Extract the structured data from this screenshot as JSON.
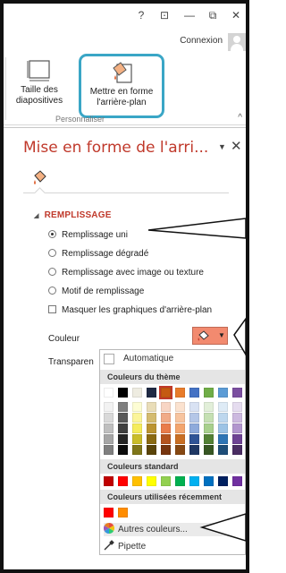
{
  "titlebar": {
    "help": "?",
    "restore_ribbon": "⊡",
    "minimize": "—",
    "maximize": "⧉",
    "close": "✕"
  },
  "account": {
    "signin_label": "Connexion"
  },
  "ribbon": {
    "slide_size_label": "Taille des diapositives",
    "format_background_label": "Mettre en forme l'arrière-plan",
    "group_label": "Personnaliser",
    "collapse": "^"
  },
  "pane": {
    "title": "Mise en forme de l'arri...",
    "dropdown": "▼",
    "close": "✕",
    "section_title": "REMPLISSAGE",
    "fill_options": [
      {
        "label": "Remplissage uni",
        "selected": true
      },
      {
        "label": "Remplissage dégradé",
        "selected": false
      },
      {
        "label": "Remplissage avec image ou texture",
        "selected": false
      },
      {
        "label": "Motif de remplissage",
        "selected": false
      }
    ],
    "hide_graphics_label": "Masquer les graphiques d'arrière-plan",
    "color_label": "Couleur",
    "transparency_label": "Transparen",
    "color_button_color": "#f28a6f"
  },
  "color_menu": {
    "automatic_label": "Automatique",
    "theme_colors_header": "Couleurs du thème",
    "theme_top_row": [
      "#ffffff",
      "#000000",
      "#eeece1",
      "#1f2a44",
      "#c55a11",
      "#e87c2b",
      "#4472c4",
      "#70ad47",
      "#5b9bd5",
      "#7b4fa0"
    ],
    "theme_columns": [
      [
        "#f2f2f2",
        "#d9d9d9",
        "#bfbfbf",
        "#a6a6a6",
        "#7f7f7f"
      ],
      [
        "#7f7f7f",
        "#595959",
        "#404040",
        "#262626",
        "#0d0d0d"
      ],
      [
        "#fdfdd4",
        "#fbf59a",
        "#f5ec5c",
        "#c9bd2a",
        "#7f761a"
      ],
      [
        "#e9ddb8",
        "#d4bb6f",
        "#bb9431",
        "#8a6a12",
        "#5a4408"
      ],
      [
        "#f8d5c4",
        "#f1ab88",
        "#e97c4b",
        "#b4541f",
        "#77350f"
      ],
      [
        "#fbe2cf",
        "#f7c49f",
        "#f3a56e",
        "#c96f24",
        "#864813"
      ],
      [
        "#d9e2f3",
        "#b4c6e7",
        "#8eaadb",
        "#2f5496",
        "#1f3864"
      ],
      [
        "#e2efd9",
        "#c5e0b3",
        "#a8d08d",
        "#538135",
        "#375623"
      ],
      [
        "#deebf6",
        "#bdd7ee",
        "#9cc3e5",
        "#2e75b5",
        "#1e4e79"
      ],
      [
        "#e5dcef",
        "#ccb9df",
        "#b296ce",
        "#6e4394",
        "#4a2d63"
      ]
    ],
    "standard_header": "Couleurs standard",
    "standard_colors": [
      "#c00000",
      "#ff0000",
      "#ffc000",
      "#ffff00",
      "#92d050",
      "#00b050",
      "#00b0f0",
      "#0070c0",
      "#002060",
      "#7030a0"
    ],
    "recent_header": "Couleurs utilisées récemment",
    "recent_colors": [
      "#ff0000",
      "#ff8c00"
    ],
    "more_colors_label": "Autres couleurs...",
    "eyedropper_label": "Pipette"
  }
}
